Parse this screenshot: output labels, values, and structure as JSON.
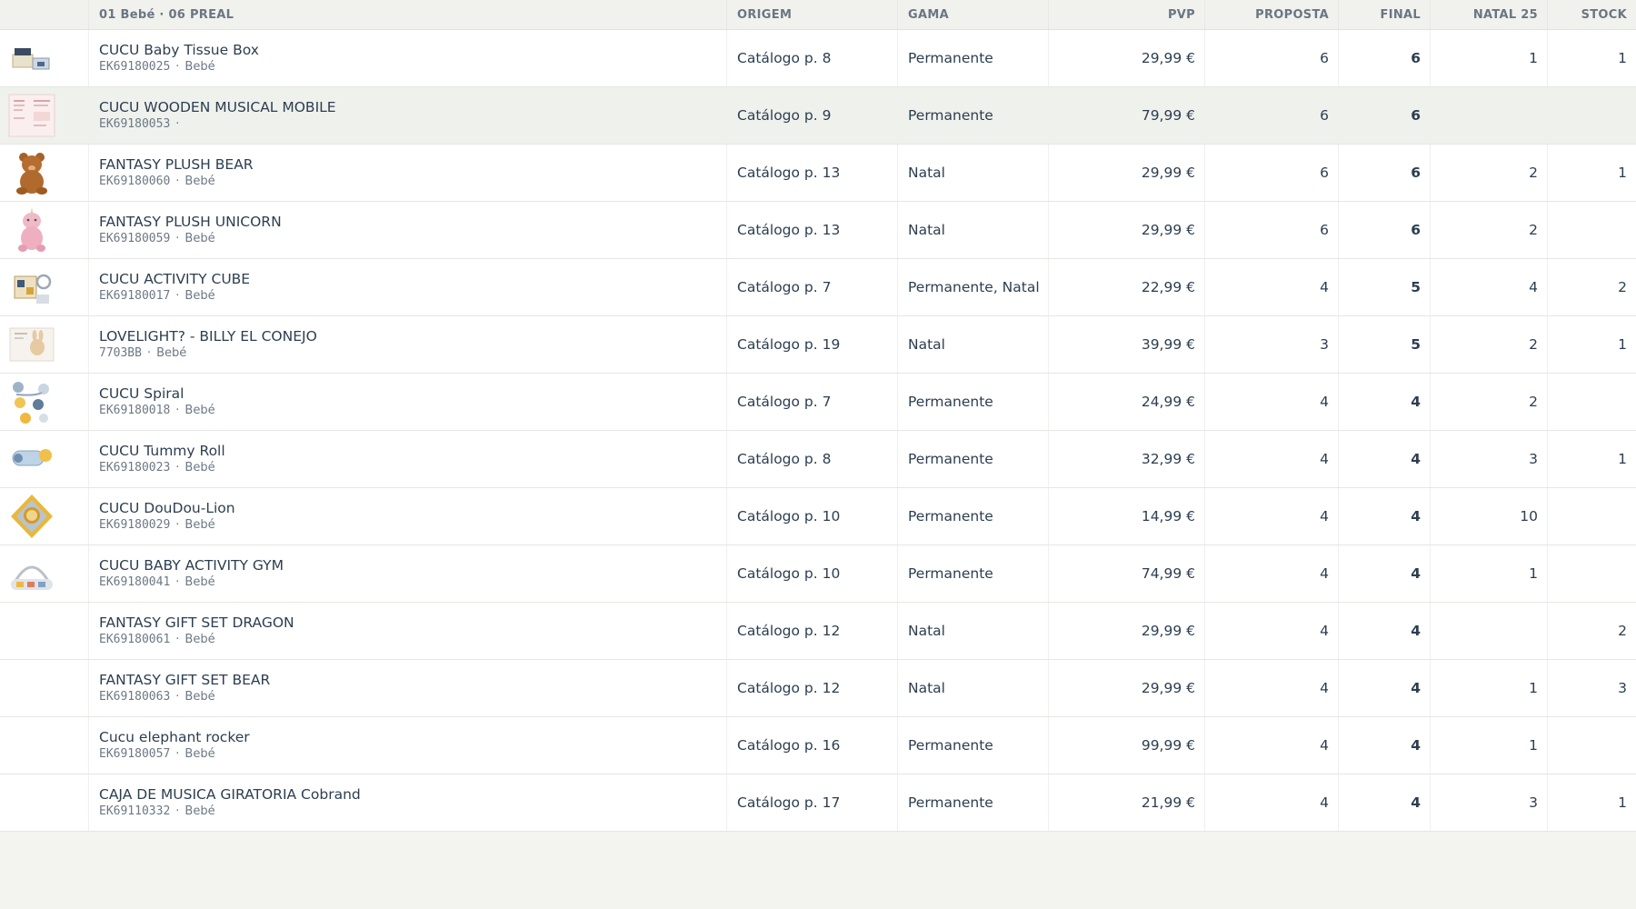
{
  "columns": {
    "product": "01 Bebé · 06 PREAL",
    "origem": "ORIGEM",
    "gama": "GAMA",
    "pvp": "PVP",
    "proposta": "PROPOSTA",
    "final": "FINAL",
    "natal": "NATAL 25",
    "stock": "STOCK"
  },
  "rows": [
    {
      "name": "CUCU Baby Tissue Box",
      "code": "EK69180025",
      "sep": "·",
      "category": "Bebé",
      "origem": "Catálogo p. 8",
      "gama": "Permanente",
      "pvp": "29,99 €",
      "proposta": "6",
      "final": "6",
      "natal": "1",
      "stock": "1",
      "thumb": "tissue-box"
    },
    {
      "name": "CUCU WOODEN MUSICAL MOBILE",
      "code": "EK69180053",
      "sep": "·",
      "category": "",
      "origem": "Catálogo p. 9",
      "gama": "Permanente",
      "pvp": "79,99 €",
      "proposta": "6",
      "final": "6",
      "natal": "",
      "stock": "",
      "thumb": "mobile-sheet"
    },
    {
      "name": "FANTASY PLUSH BEAR",
      "code": "EK69180060",
      "sep": "·",
      "category": "Bebé",
      "origem": "Catálogo p. 13",
      "gama": "Natal",
      "pvp": "29,99 €",
      "proposta": "6",
      "final": "6",
      "natal": "2",
      "stock": "1",
      "thumb": "bear"
    },
    {
      "name": "FANTASY PLUSH UNICORN",
      "code": "EK69180059",
      "sep": "·",
      "category": "Bebé",
      "origem": "Catálogo p. 13",
      "gama": "Natal",
      "pvp": "29,99 €",
      "proposta": "6",
      "final": "6",
      "natal": "2",
      "stock": "",
      "thumb": "unicorn"
    },
    {
      "name": "CUCU ACTIVITY CUBE",
      "code": "EK69180017",
      "sep": "·",
      "category": "Bebé",
      "origem": "Catálogo p. 7",
      "gama": "Permanente, Natal",
      "pvp": "22,99 €",
      "proposta": "4",
      "final": "5",
      "natal": "4",
      "stock": "2",
      "thumb": "cube"
    },
    {
      "name": "LOVELIGHT? - BILLY EL CONEJO",
      "code": "7703BB",
      "sep": "·",
      "category": "Bebé",
      "origem": "Catálogo p. 19",
      "gama": "Natal",
      "pvp": "39,99 €",
      "proposta": "3",
      "final": "5",
      "natal": "2",
      "stock": "1",
      "thumb": "bunny-box"
    },
    {
      "name": "CUCU Spiral",
      "code": "EK69180018",
      "sep": "·",
      "category": "Bebé",
      "origem": "Catálogo p. 7",
      "gama": "Permanente",
      "pvp": "24,99 €",
      "proposta": "4",
      "final": "4",
      "natal": "2",
      "stock": "",
      "thumb": "spiral"
    },
    {
      "name": "CUCU Tummy Roll",
      "code": "EK69180023",
      "sep": "·",
      "category": "Bebé",
      "origem": "Catálogo p. 8",
      "gama": "Permanente",
      "pvp": "32,99 €",
      "proposta": "4",
      "final": "4",
      "natal": "3",
      "stock": "1",
      "thumb": "roll"
    },
    {
      "name": "CUCU DouDou-Lion",
      "code": "EK69180029",
      "sep": "·",
      "category": "Bebé",
      "origem": "Catálogo p. 10",
      "gama": "Permanente",
      "pvp": "14,99 €",
      "proposta": "4",
      "final": "4",
      "natal": "10",
      "stock": "",
      "thumb": "lion"
    },
    {
      "name": "CUCU BABY ACTIVITY GYM",
      "code": "EK69180041",
      "sep": "·",
      "category": "Bebé",
      "origem": "Catálogo p. 10",
      "gama": "Permanente",
      "pvp": "74,99 €",
      "proposta": "4",
      "final": "4",
      "natal": "1",
      "stock": "",
      "thumb": "gym"
    },
    {
      "name": "FANTASY GIFT SET DRAGON",
      "code": "EK69180061",
      "sep": "·",
      "category": "Bebé",
      "origem": "Catálogo p. 12",
      "gama": "Natal",
      "pvp": "29,99 €",
      "proposta": "4",
      "final": "4",
      "natal": "",
      "stock": "2",
      "thumb": ""
    },
    {
      "name": "FANTASY GIFT SET BEAR",
      "code": "EK69180063",
      "sep": "·",
      "category": "Bebé",
      "origem": "Catálogo p. 12",
      "gama": "Natal",
      "pvp": "29,99 €",
      "proposta": "4",
      "final": "4",
      "natal": "1",
      "stock": "3",
      "thumb": ""
    },
    {
      "name": "Cucu elephant rocker",
      "code": "EK69180057",
      "sep": "·",
      "category": "Bebé",
      "origem": "Catálogo p. 16",
      "gama": "Permanente",
      "pvp": "99,99 €",
      "proposta": "4",
      "final": "4",
      "natal": "1",
      "stock": "",
      "thumb": ""
    },
    {
      "name": "CAJA DE MUSICA GIRATORIA Cobrand",
      "code": "EK69110332",
      "sep": "·",
      "category": "Bebé",
      "origem": "Catálogo p. 17",
      "gama": "Permanente",
      "pvp": "21,99 €",
      "proposta": "4",
      "final": "4",
      "natal": "3",
      "stock": "1",
      "thumb": ""
    }
  ],
  "highlighted_row": 1,
  "colors": {
    "header_bg": "#f1f2ee",
    "row_highlight": "#eff1ed",
    "page_bg": "#f3f4f0"
  }
}
